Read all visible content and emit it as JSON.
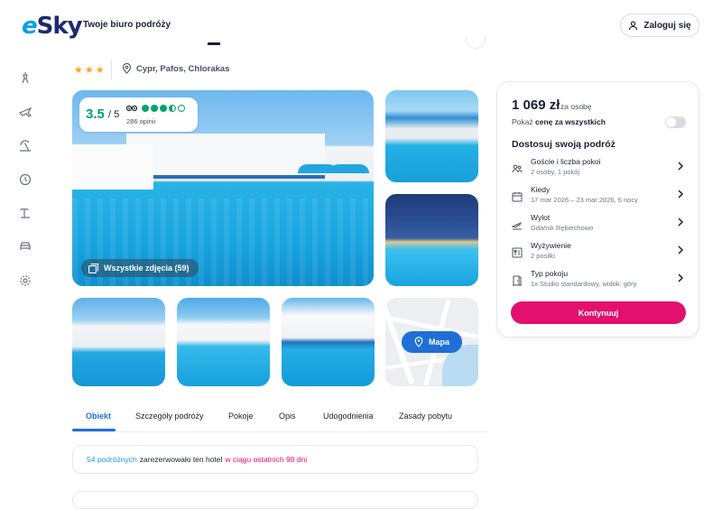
{
  "header": {
    "logo_text": "eSky",
    "tagline": "Twoje biuro podróży",
    "login_label": "Zaloguj się"
  },
  "sidebar": {
    "items": [
      {
        "icon": "tower-icon"
      },
      {
        "icon": "plane-icon"
      },
      {
        "icon": "beach-umbrella-icon"
      },
      {
        "icon": "clock-icon"
      },
      {
        "icon": "island-icon"
      },
      {
        "icon": "car-icon"
      },
      {
        "icon": "gear-icon"
      }
    ]
  },
  "hotel": {
    "stars": "★★★",
    "location": "Cypr, Pafos, Chlorakas"
  },
  "rating": {
    "score": "3.5",
    "max": "/ 5",
    "reviews": "286 opinii",
    "dots_filled": 3.5,
    "dots_total": 5
  },
  "gallery": {
    "all_photos_label": "Wszystkie zdjęcia (59)",
    "map_label": "Mapa"
  },
  "tabs": [
    {
      "label": "Obiekt",
      "active": true
    },
    {
      "label": "Szczegóły podróży",
      "active": false
    },
    {
      "label": "Pokoje",
      "active": false
    },
    {
      "label": "Opis",
      "active": false
    },
    {
      "label": "Udogodnienia",
      "active": false
    },
    {
      "label": "Zasady pobytu",
      "active": false
    }
  ],
  "booked_notice": {
    "count_text": "54 podróżnych",
    "middle_text": "zarezerwowało ten hotel",
    "period_text": "w ciągu ostatnich 90 dni"
  },
  "booking": {
    "price": "1 069 zł",
    "per": "za osobę",
    "total_toggle_prefix": "Pokaż",
    "total_toggle_bold": "cenę za wszystkich",
    "customize_title": "Dostosuj swoją podróż",
    "options": [
      {
        "label": "Goście i liczba pokoi",
        "value": "2 osoby, 1 pokój",
        "icon": "guests-icon"
      },
      {
        "label": "Kiedy",
        "value": "17 mar 2026 – 23 mar 2026, 6 nocy",
        "icon": "calendar-icon"
      },
      {
        "label": "Wylot",
        "value": "Gdańsk Rębiechowo",
        "icon": "takeoff-icon"
      },
      {
        "label": "Wyżywienie",
        "value": "2 posiłki",
        "icon": "meal-icon"
      },
      {
        "label": "Typ pokoju",
        "value": "1x Studio standardowy, widok: góry",
        "icon": "door-icon"
      }
    ],
    "continue_label": "Kontynuuj"
  },
  "colors": {
    "brand_navy": "#1d2a6e",
    "brand_blue": "#1f6fd6",
    "cta_pink": "#e3106d",
    "rating_green": "#00a36c",
    "star_orange": "#f6a623"
  }
}
